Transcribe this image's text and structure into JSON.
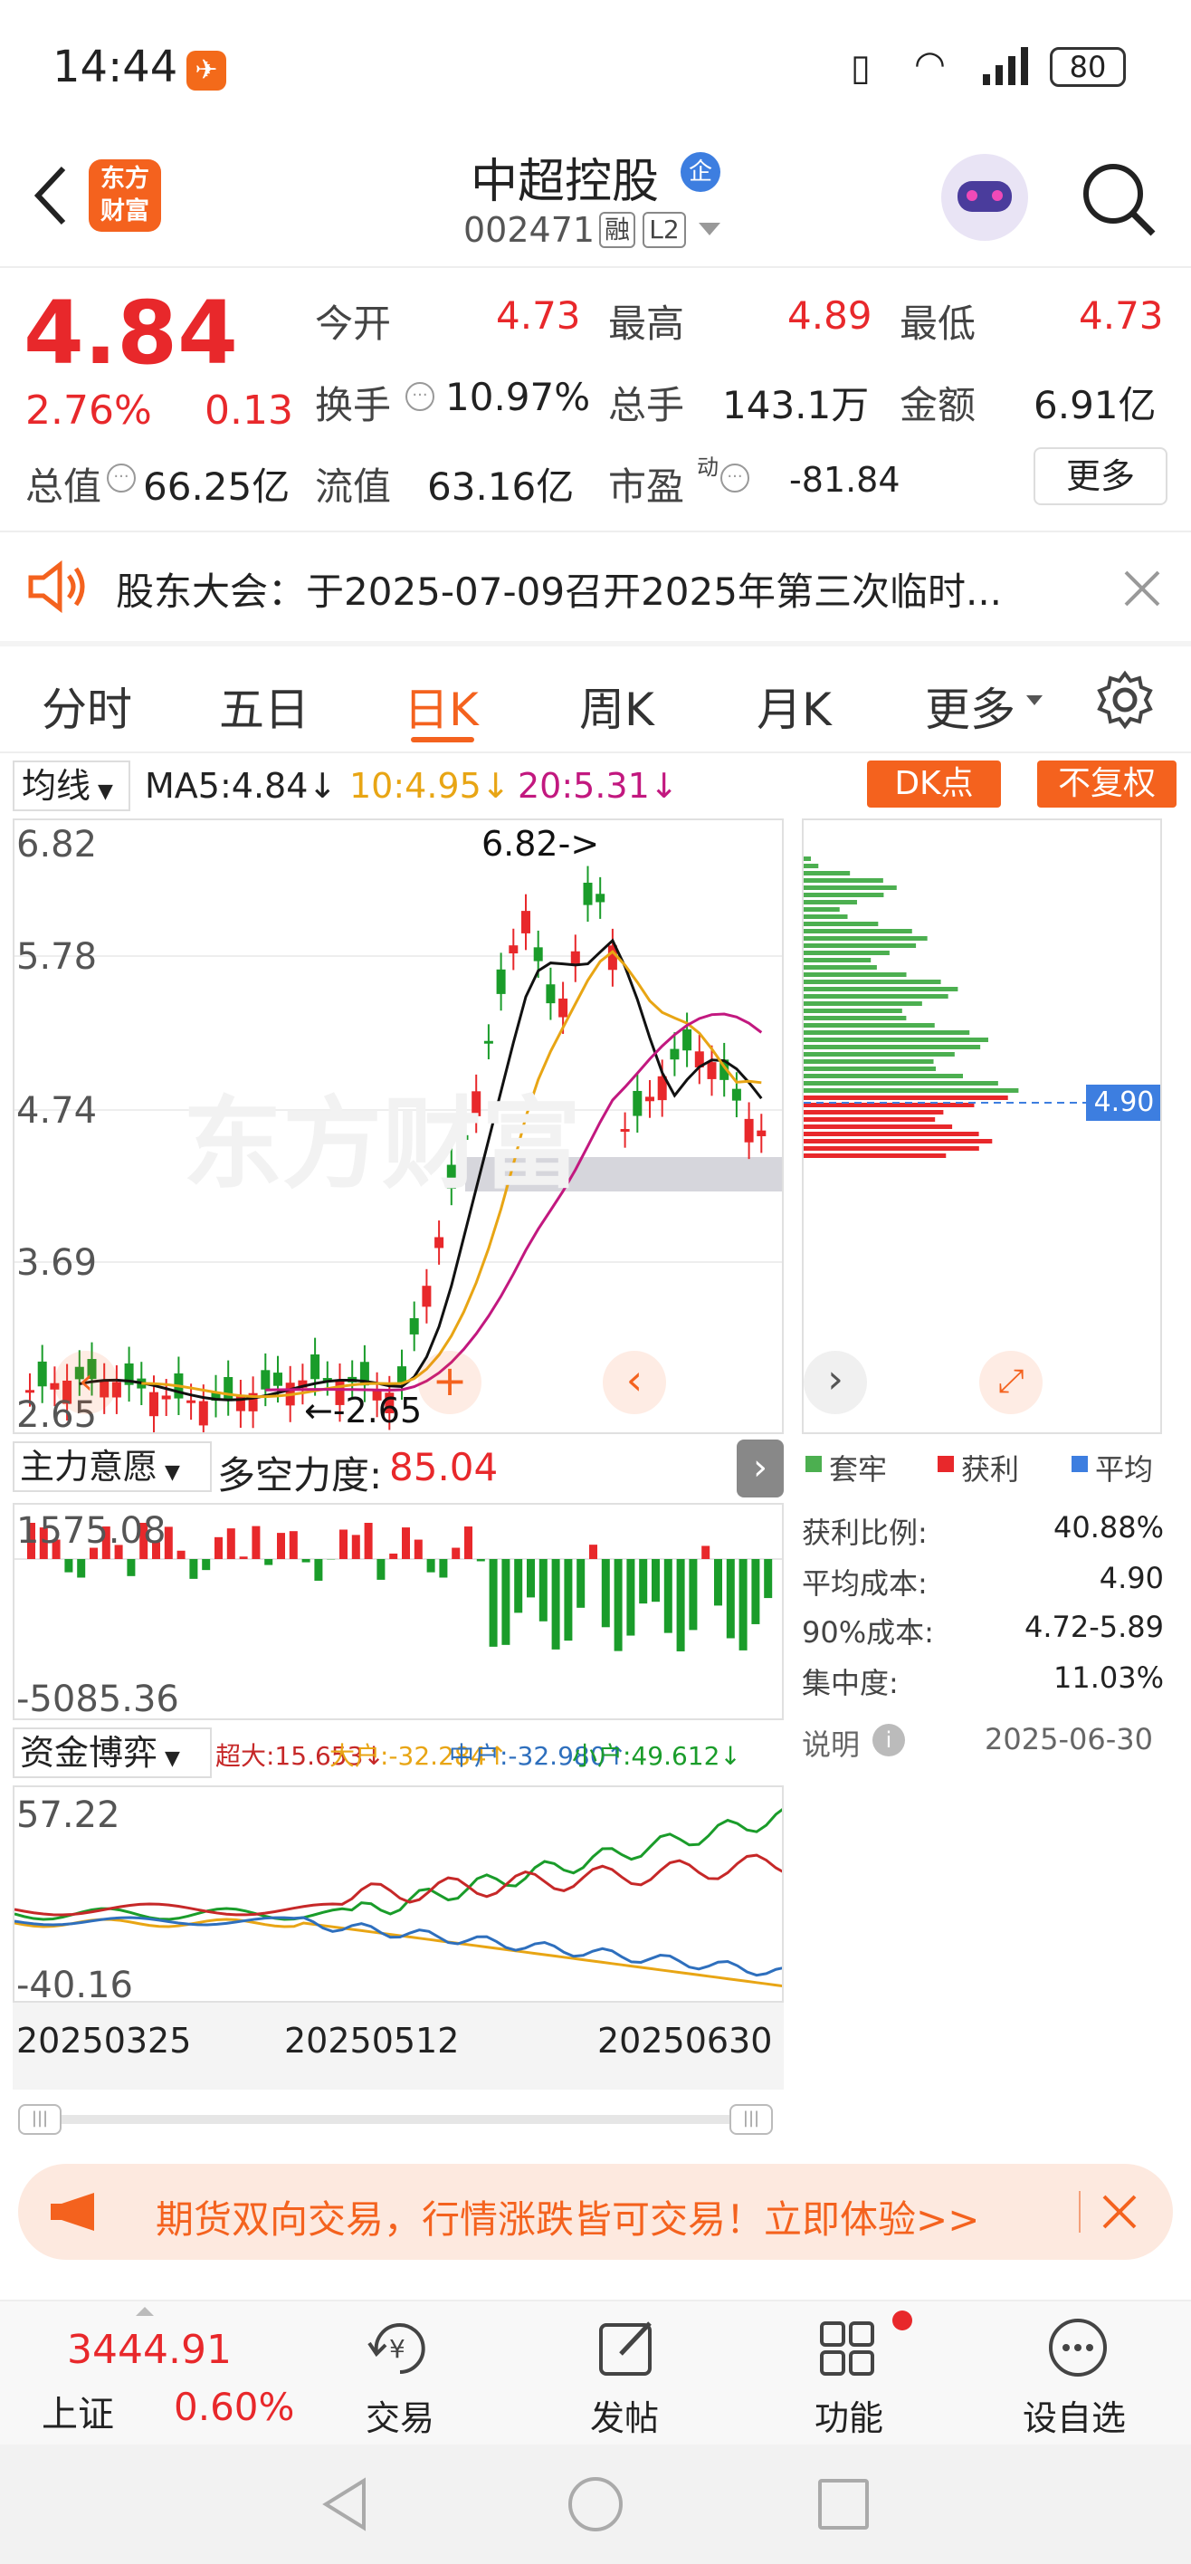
{
  "status": {
    "time": "14:44",
    "battery": "80"
  },
  "header": {
    "title": "中超控股",
    "title_badge": "企",
    "code": "002471",
    "tag1": "融",
    "tag2": "L2",
    "logo_line1": "东方",
    "logo_line2": "财富"
  },
  "quote": {
    "price": "4.84",
    "pct": "2.76%",
    "chg": "0.13",
    "open_label": "今开",
    "open": "4.73",
    "high_label": "最高",
    "high": "4.89",
    "low_label": "最低",
    "low": "4.73",
    "turnover_label": "换手",
    "turnover": "10.97%",
    "volume_label": "总手",
    "volume": "143.1万",
    "amount_label": "金额",
    "amount": "6.91亿",
    "mktcap_label": "总值",
    "mktcap": "66.25亿",
    "float_label": "流值",
    "float": "63.16亿",
    "pe_label": "市盈",
    "pe_sup": "动",
    "pe": "-81.84",
    "more_label": "更多"
  },
  "notice": {
    "text": "股东大会：于2025-07-09召开2025年第三次临时..."
  },
  "tabs": [
    "分时",
    "五日",
    "日K",
    "周K",
    "月K",
    "更多"
  ],
  "active_tab": 2,
  "kline": {
    "ma_select": "均线",
    "ma5": "MA5:4.84↓",
    "ma10": "10:4.95↓",
    "ma20": "20:5.31↓",
    "dk_btn": "DK点",
    "fq_btn": "不复权",
    "y_labels": [
      "6.82",
      "5.78",
      "4.74",
      "3.69",
      "2.65"
    ],
    "high_mark": "6.82->",
    "low_mark": "←-2.65",
    "watermark": "东方财富",
    "chip_price": "4.90"
  },
  "indicator1": {
    "select": "主力意愿",
    "name": "多空力度:",
    "value": "85.04",
    "top": "1575.08",
    "bottom": "-5085.36"
  },
  "indicator2": {
    "select": "资金博弈",
    "sd": "超大:15.653↓",
    "dh": "大户:-32.284↑",
    "zh": "中户:-32.980↑",
    "xh": "小户:49.612↓",
    "top": "57.22",
    "bottom": "-40.16"
  },
  "dates": [
    "20250325",
    "20250512",
    "20250630"
  ],
  "chip": {
    "legend": [
      "套牢",
      "获利",
      "平均"
    ],
    "rows": [
      {
        "k": "获利比例:",
        "v": "40.88%"
      },
      {
        "k": "平均成本:",
        "v": "4.90"
      },
      {
        "k": "90%成本:",
        "v": "4.72-5.89"
      },
      {
        "k": "集中度:",
        "v": "11.03%"
      }
    ],
    "note_label": "说明",
    "note_date": "2025-06-30"
  },
  "ad": {
    "text": "期货双向交易，行情涨跌皆可交易！立即体验>>"
  },
  "bottom": {
    "index_value": "3444.91",
    "index_name": "上证",
    "index_pct": "0.60%",
    "trade": "交易",
    "post": "发帖",
    "func": "功能",
    "watch": "设自选"
  }
}
